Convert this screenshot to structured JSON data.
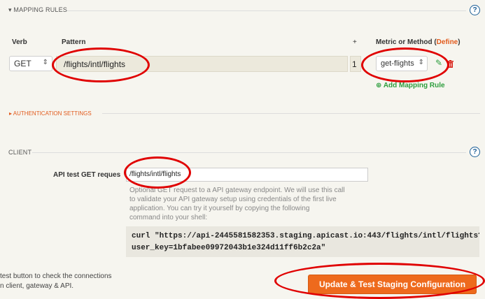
{
  "mapping": {
    "section_title": "▾ MAPPING RULES",
    "col_verb": "Verb",
    "col_pattern": "Pattern",
    "col_plus": "+",
    "col_metric": "Metric or Method (",
    "col_define": "Define",
    "col_metric_end": ")",
    "verb_value": "GET",
    "pattern_value": "/flights/intl/flights",
    "delta_value": "1",
    "metric_value": "get-flights",
    "add_rule_label": "Add Mapping Rule"
  },
  "auth": {
    "section_title": "▸ AUTHENTICATION SETTINGS"
  },
  "client": {
    "section_title": "CLIENT",
    "api_test_label": "API test GET reques",
    "api_test_value": "/flights/intl/flights",
    "desc_lines": [
      "Optional GET request to a API gateway endpoint. We will use this call",
      "to validate your API gateway setup using credentials of the first live",
      "application. You can try it yourself by copying the following",
      "command into your shell:"
    ],
    "curl_lines": [
      "curl \"https://api-2445581582353.staging.apicast.io:443/flights/intl/flights?",
      "user_key=1bfabee09972043b1e324d11ff6b2c2a\""
    ]
  },
  "footer": {
    "hint_lines": [
      "test button to check the connections",
      "n client, gateway & API."
    ],
    "update_button": "Update & Test Staging Configuration"
  },
  "icons": {
    "help": "?",
    "edit": "✎",
    "delete": "🗑",
    "add": "⊕",
    "select_arrows": "⇕"
  },
  "colors": {
    "accent_orange": "#ee6a1d",
    "link_orange": "#e25a1c",
    "green": "#2e9e3e",
    "help_blue": "#1b5e96",
    "annotation_red": "#e00000"
  }
}
